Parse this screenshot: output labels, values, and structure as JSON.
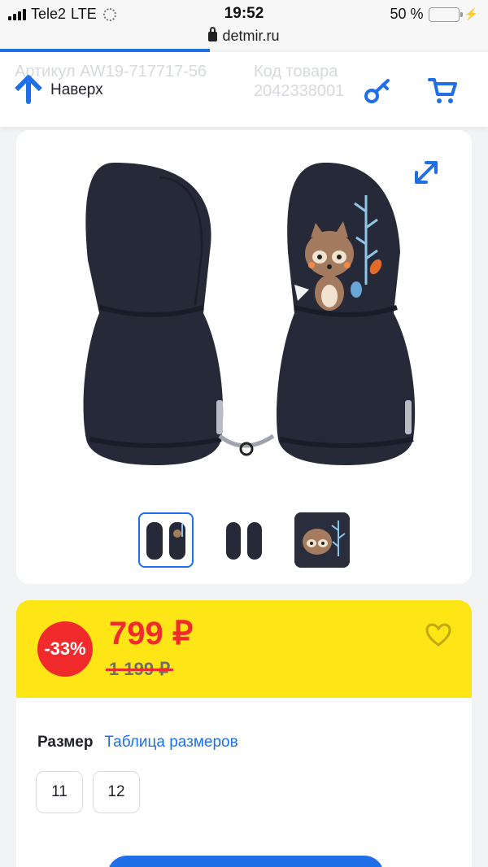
{
  "status_bar": {
    "carrier": "Tele2",
    "network": "LTE",
    "time": "19:52",
    "battery": "50 %",
    "battery_level": 0.5
  },
  "browser": {
    "url": "detmir.ru"
  },
  "header": {
    "back_to_top_label": "Наверх",
    "article_ghost": "Артикул AW19-717717-56",
    "code_ghost": "Код товара 2042338001"
  },
  "product": {
    "thumbnails": [
      "front",
      "back",
      "detail"
    ]
  },
  "pricing": {
    "discount": "-33%",
    "price": "799 ₽",
    "old_price": "1 199 ₽"
  },
  "size": {
    "label": "Размер",
    "table_link": "Таблица размеров",
    "options": [
      "11",
      "12"
    ]
  },
  "colors": {
    "accent": "#1f6fe8",
    "price_bg": "#fee515",
    "discount_red": "#f12b2b",
    "mitten": "#262a38"
  }
}
